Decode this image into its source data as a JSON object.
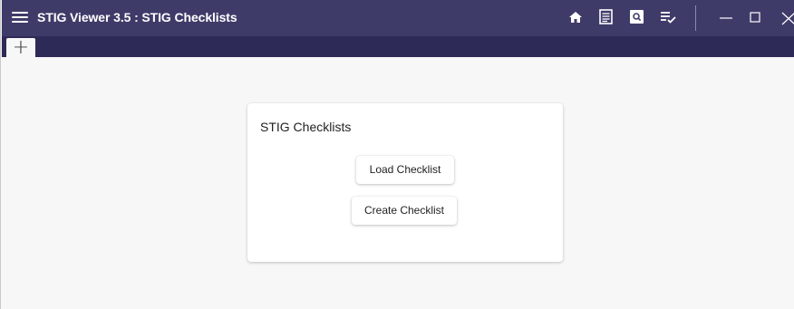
{
  "app": {
    "title": "STIG Viewer 3.5 : STIG Checklists"
  },
  "titlebar": {
    "icons": [
      "home-icon",
      "notes-icon",
      "search-icon",
      "checklist-icon"
    ],
    "window_controls": [
      "minimize-icon",
      "maximize-icon",
      "close-icon"
    ]
  },
  "tabs": {
    "add_label": "+"
  },
  "main": {
    "card_title": "STIG Checklists",
    "buttons": {
      "load": "Load Checklist",
      "create": "Create Checklist"
    }
  },
  "colors": {
    "titlebar": "#3f3b69",
    "tabbar": "#2e2a57",
    "content_bg": "#f7f7f7",
    "card_bg": "#ffffff"
  }
}
